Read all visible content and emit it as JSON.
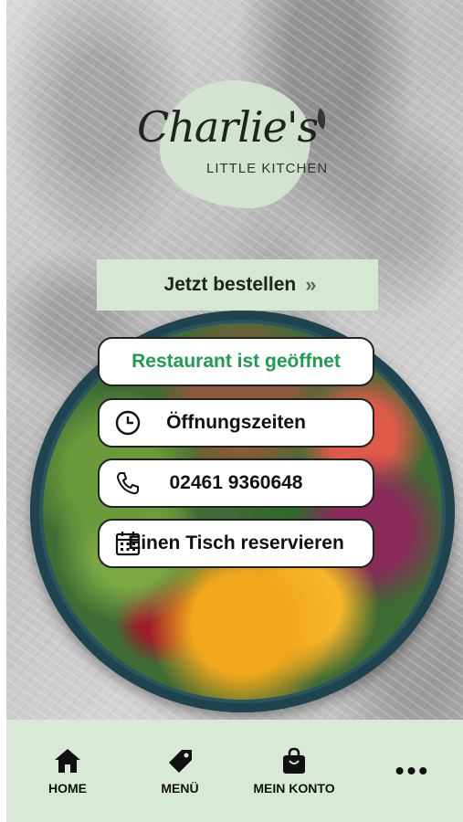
{
  "brand": {
    "name": "Charlie's",
    "tagline": "LITTLE KITCHEN"
  },
  "order_button": {
    "label": "Jetzt bestellen",
    "icon": "double-chevron-right-icon"
  },
  "actions": {
    "status": "Restaurant ist geöffnet",
    "hours": "Öffnungszeiten",
    "phone": "02461 9360648",
    "reserve": "Einen Tisch reservieren"
  },
  "nav": {
    "items": [
      {
        "label": "HOME",
        "icon": "home-icon"
      },
      {
        "label": "MENÜ",
        "icon": "tag-icon"
      },
      {
        "label": "MEIN KONTO",
        "icon": "shopping-bag-icon"
      },
      {
        "label": "",
        "icon": "more-icon"
      }
    ]
  },
  "colors": {
    "accent_green": "#1f9c4f",
    "mint": "#d5e8d2"
  }
}
